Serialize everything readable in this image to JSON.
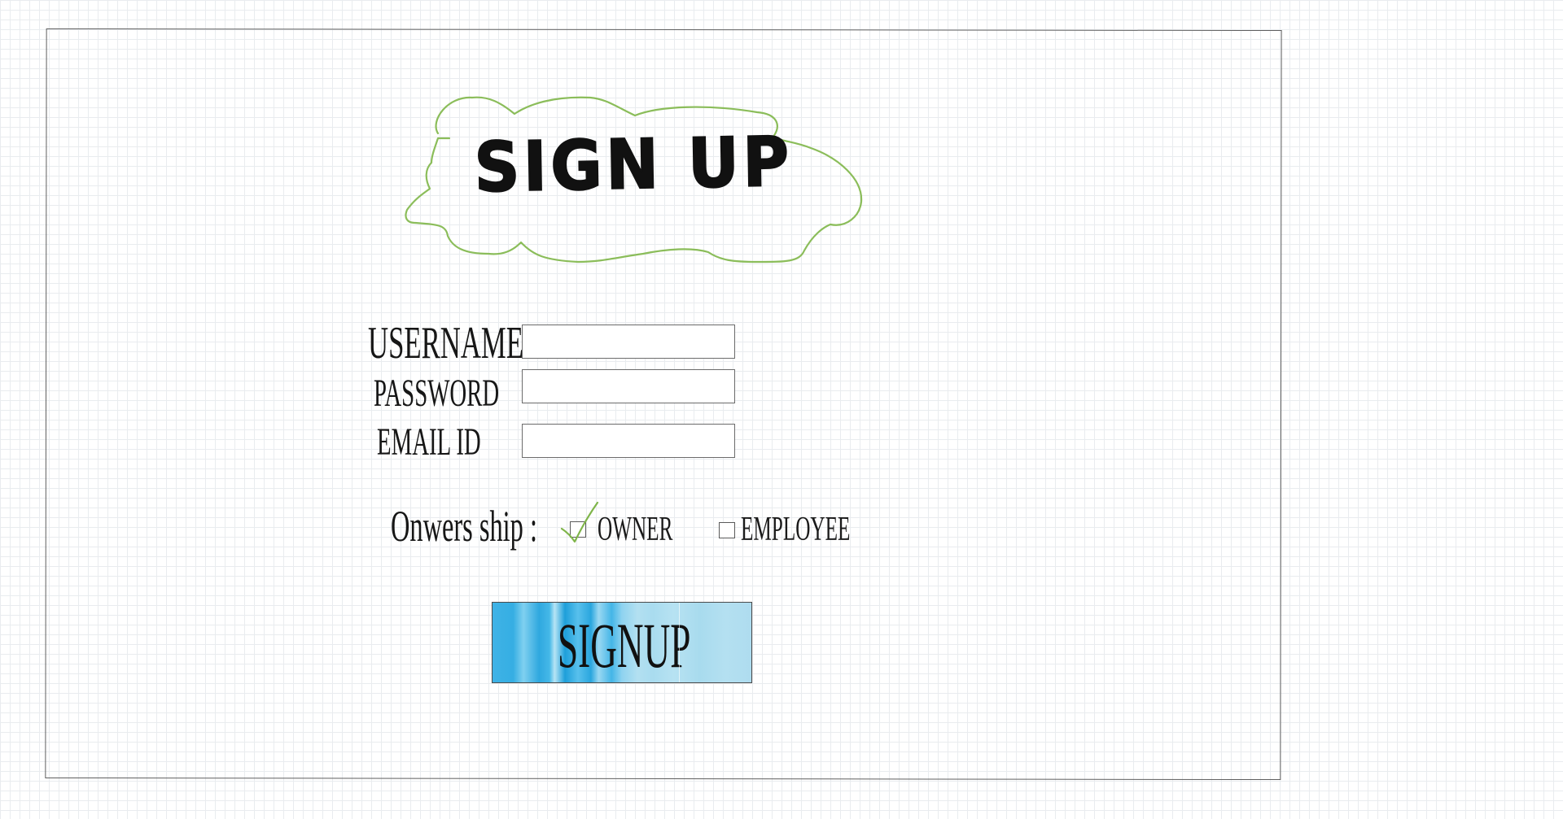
{
  "form": {
    "title": "SIGN UP",
    "fields": {
      "username": {
        "label": "USERNAME",
        "value": "",
        "placeholder": ""
      },
      "password": {
        "label": "PASSWORD",
        "value": "",
        "placeholder": ""
      },
      "email": {
        "label": "EMAIL ID",
        "value": "",
        "placeholder": ""
      }
    },
    "ownership": {
      "label": "Onwers ship :",
      "options": [
        {
          "label": "OWNER",
          "checked": true
        },
        {
          "label": "EMPLOYEE",
          "checked": false
        }
      ]
    },
    "submit_label": "SIGNUP"
  },
  "colors": {
    "cloud_outline": "#8bbd5a",
    "checkmark": "#7fb54a",
    "button_blue": "#3fb3e6",
    "frame": "#5f5f5f"
  },
  "icons": {
    "cloud": "cloud-outline-icon",
    "check": "checkmark-icon"
  }
}
